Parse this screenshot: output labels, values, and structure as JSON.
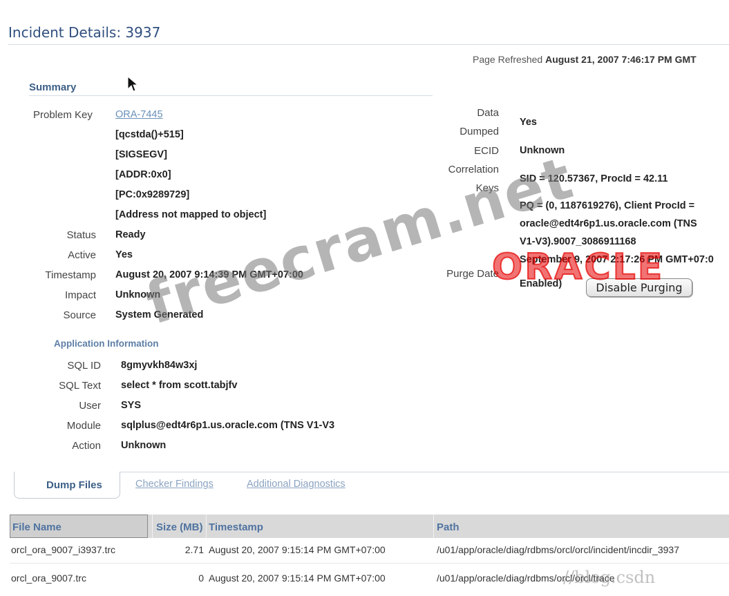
{
  "header": {
    "title": "Incident Details: 3937",
    "refreshed_label": "Page Refreshed",
    "refreshed_value": "August 21, 2007 7:46:17 PM GMT"
  },
  "summary": {
    "title": "Summary",
    "problem_key_label": "Problem Key",
    "problem_key_link": "ORA-7445",
    "problem_key_lines": [
      "[qcstda()+515]",
      "[SIGSEGV]",
      "[ADDR:0x0]",
      "[PC:0x9289729]",
      "[Address not mapped to object]"
    ],
    "status_label": "Status",
    "status_value": "Ready",
    "active_label": "Active",
    "active_value": "Yes",
    "timestamp_label": "Timestamp",
    "timestamp_value": "August 20, 2007 9:14:39 PM GMT+07:00",
    "impact_label": "Impact",
    "impact_value": "Unknown",
    "source_label": "Source",
    "source_value": "System Generated"
  },
  "app_info": {
    "title": "Application Information",
    "sql_id_label": "SQL ID",
    "sql_id_value": "8gmyvkh84w3xj",
    "sql_text_label": "SQL Text",
    "sql_text_value": "select * from scott.tabjfv",
    "user_label": "User",
    "user_value": "SYS",
    "module_label": "Module",
    "module_value": "sqlplus@edt4r6p1.us.oracle.com (TNS V1-V3",
    "action_label": "Action",
    "action_value": "Unknown"
  },
  "right": {
    "data_dumped_label_1": "Data",
    "data_dumped_label_2": "Dumped",
    "data_dumped_value": "Yes",
    "ecid_label": "ECID",
    "ecid_value": "Unknown",
    "correlation_label_1": "Correlation",
    "correlation_label_2": "Keys",
    "correlation_value_1": "SID = 120.57367, ProcId = 42.11",
    "correlation_value_2": "PQ = (0, 1187619276), Client ProcId =",
    "correlation_value_3": "oracle@edt4r6p1.us.oracle.com (TNS",
    "correlation_value_4": "V1-V3).9007_3086911168",
    "purge_date_label": "Purge Date",
    "purge_date_value": "September 9, 2007 2:17:26 PM GMT+07:0",
    "purge_enabled": "Enabled)",
    "disable_purging_button": "Disable Purging"
  },
  "tabs": {
    "dump_files": "Dump Files",
    "checker_findings": "Checker Findings",
    "additional_diagnostics": "Additional Diagnostics"
  },
  "table": {
    "headers": {
      "file_name": "File Name",
      "size": "Size (MB)",
      "timestamp": "Timestamp",
      "path": "Path"
    },
    "rows": [
      {
        "file_name": "orcl_ora_9007_i3937.trc",
        "size": "2.71",
        "timestamp": "August 20, 2007 9:15:14 PM GMT+07:00",
        "path": "/u01/app/oracle/diag/rdbms/orcl/orcl/incident/incdir_3937"
      },
      {
        "file_name": "orcl_ora_9007.trc",
        "size": "0",
        "timestamp": "August 20, 2007 9:15:14 PM GMT+07:00",
        "path": "/u01/app/oracle/diag/rdbms/orcl/orcl/trace"
      }
    ]
  },
  "watermarks": {
    "freecram": "freecram.net",
    "oracle": "ORACLE",
    "csdn": "//blog.csdn"
  }
}
